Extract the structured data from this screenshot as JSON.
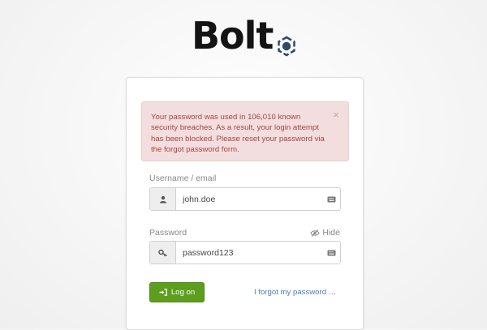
{
  "brand": {
    "logo_text": "Bolt"
  },
  "alert": {
    "message": "Your password was used in 106,010 known security breaches. As a result, your login attempt has been blocked. Please reset your password via the forgot password form.",
    "close_symbol": "×"
  },
  "form": {
    "username_label": "Username / email",
    "username_value": "john.doe",
    "password_label": "Password",
    "password_value": "password123",
    "hide_label": "Hide",
    "login_label": "Log on",
    "forgot_label": "I forgot my password …"
  },
  "colors": {
    "alert_bg": "#f2dede",
    "alert_text": "#a94442",
    "login_button": "#5e9e1f",
    "link": "#4a80b8"
  },
  "icons": [
    "user-icon",
    "key-icon",
    "keyboard-icon",
    "eye-slash-icon",
    "sign-in-icon",
    "bolt-logo-mark"
  ]
}
